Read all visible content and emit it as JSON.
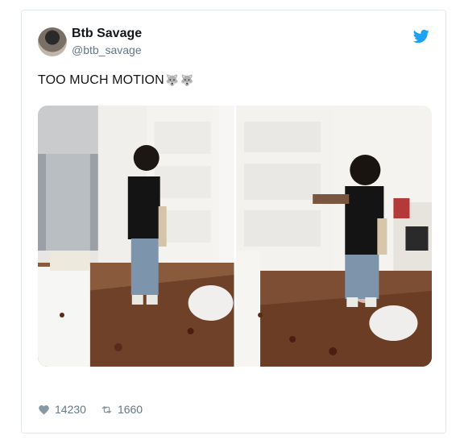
{
  "tweet": {
    "author_name": "Btb Savage",
    "author_handle": "@btb_savage",
    "text": "TOO MUCH MOTION",
    "emojis": [
      "🐺",
      "🐺"
    ],
    "likes": "14230",
    "retweets": "1660"
  },
  "icons": {
    "brand": "twitter-bird-icon",
    "like": "heart-icon",
    "retweet": "retweet-icon"
  },
  "colors": {
    "twitter_blue": "#1da1f2",
    "secondary_text": "#657786",
    "border": "#e1e8ed"
  }
}
